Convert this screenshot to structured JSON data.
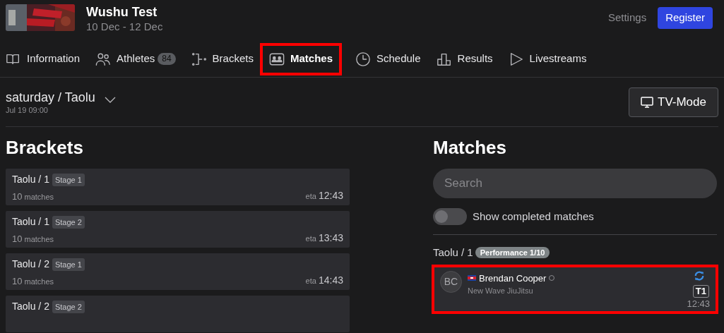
{
  "event": {
    "title": "Wushu Test",
    "dates": "10 Dec - 12 Dec"
  },
  "header_actions": {
    "settings": "Settings",
    "register": "Register"
  },
  "tabs": [
    {
      "label": "Information",
      "kind": "book",
      "selected": false,
      "highlighted": false
    },
    {
      "label": "Athletes",
      "kind": "people",
      "count": "84",
      "selected": false,
      "highlighted": false
    },
    {
      "label": "Brackets",
      "kind": "bracket",
      "selected": false,
      "highlighted": false
    },
    {
      "label": "Matches",
      "kind": "match",
      "selected": true,
      "highlighted": true
    },
    {
      "label": "Schedule",
      "kind": "clock",
      "selected": false,
      "highlighted": false
    },
    {
      "label": "Results",
      "kind": "podium",
      "selected": false,
      "highlighted": false
    },
    {
      "label": "Livestreams",
      "kind": "play",
      "selected": false,
      "highlighted": false
    }
  ],
  "session": {
    "title": "saturday / Taolu",
    "time": "Jul 19 09:00",
    "tv_mode": "TV-Mode"
  },
  "brackets": {
    "heading": "Brackets",
    "items": [
      {
        "name": "Taolu / 1",
        "stage": "Stage 1",
        "count": "10",
        "count_label": "matches",
        "eta_label": "eta",
        "eta": "12:43"
      },
      {
        "name": "Taolu / 1",
        "stage": "Stage 2",
        "count": "10",
        "count_label": "matches",
        "eta_label": "eta",
        "eta": "13:43"
      },
      {
        "name": "Taolu / 2",
        "stage": "Stage 1",
        "count": "10",
        "count_label": "matches",
        "eta_label": "eta",
        "eta": "14:43"
      },
      {
        "name": "Taolu / 2",
        "stage": "Stage 2"
      }
    ]
  },
  "matches": {
    "heading": "Matches",
    "search": {
      "placeholder": "Search"
    },
    "show_completed": {
      "label": "Show completed matches",
      "on": false
    },
    "groups": [
      {
        "name": "Taolu / 1",
        "badge": "Performance 1/10",
        "items": [
          {
            "initials": "BC",
            "athlete": "Brendan Cooper",
            "club": "New Wave JiuJitsu",
            "table": "T1",
            "time": "12:43",
            "highlighted": true
          }
        ]
      }
    ]
  }
}
